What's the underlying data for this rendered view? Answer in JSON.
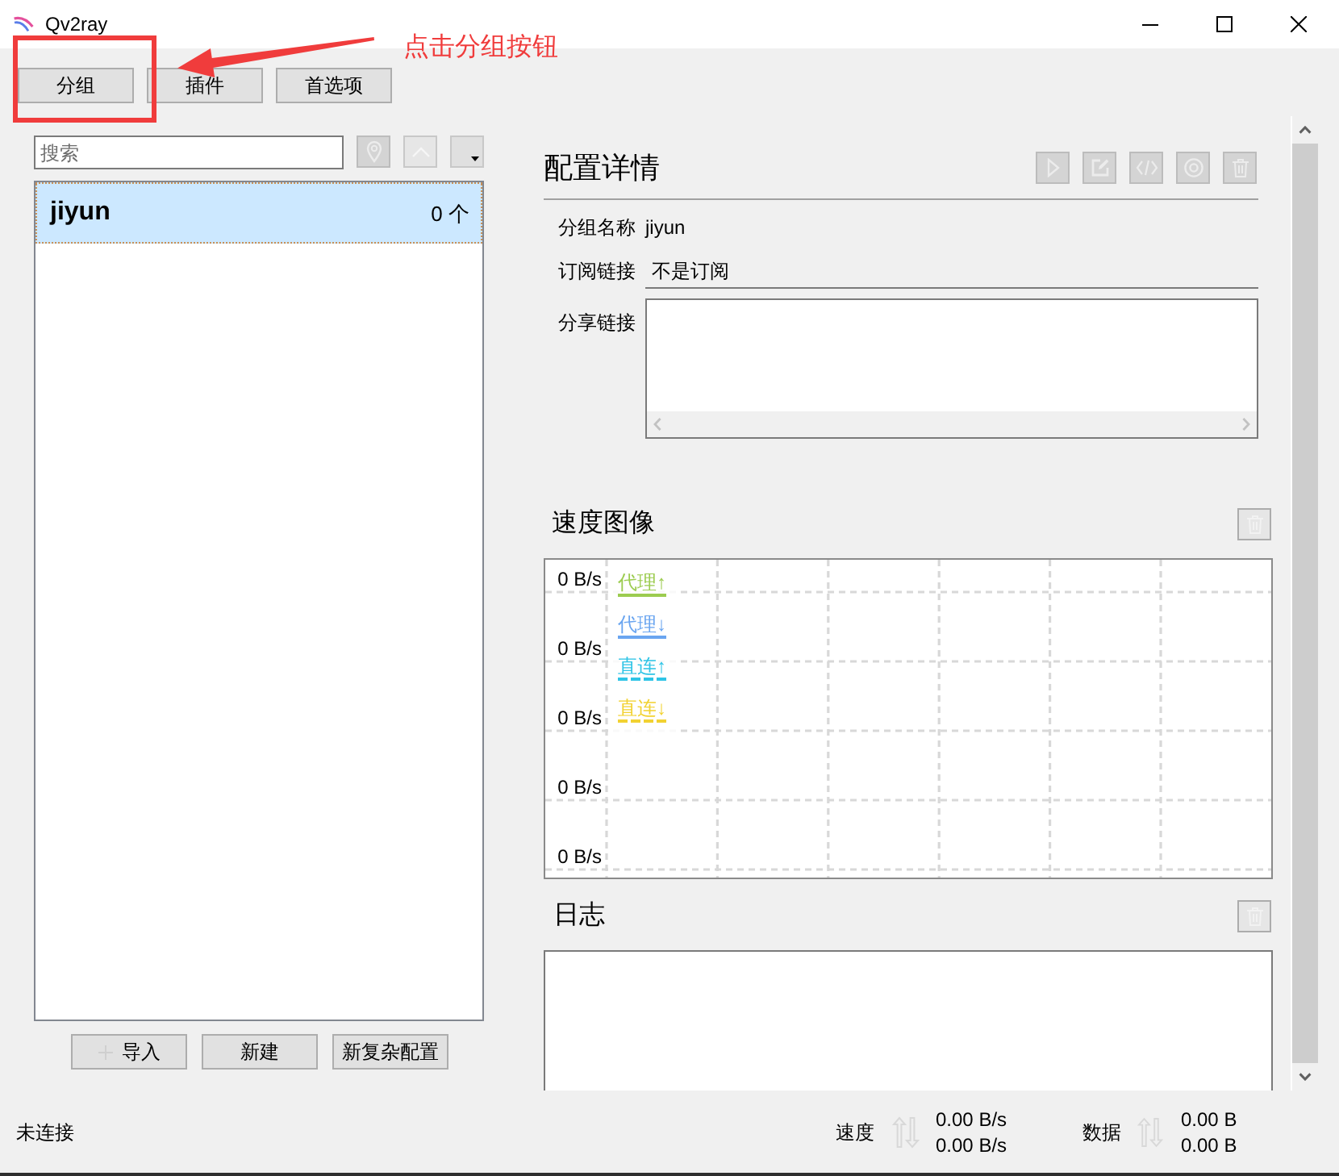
{
  "window": {
    "title": "Qv2ray"
  },
  "annotation": {
    "text": "点击分组按钮"
  },
  "toolbar": [
    {
      "label": "分组"
    },
    {
      "label": "插件"
    },
    {
      "label": "首选项"
    }
  ],
  "group_list": {
    "search": {
      "placeholder": "搜索"
    },
    "items": [
      {
        "name": "jiyun",
        "count": "0 个",
        "selected": true
      }
    ],
    "buttons": [
      {
        "label": "导入",
        "icon": true
      },
      {
        "label": "新建",
        "icon": false
      },
      {
        "label": "新复杂配置",
        "icon": false
      }
    ]
  },
  "details": {
    "title": "配置详情",
    "actions_disabled": true,
    "fields": [
      {
        "kind": "text",
        "label": "分组名称",
        "value": "jiyun"
      },
      {
        "kind": "line",
        "label": "订阅链接",
        "value": "不是订阅"
      },
      {
        "kind": "textarea",
        "label": "分享链接"
      }
    ]
  },
  "speed_chart": {
    "title": "速度图像",
    "clear_disabled": true,
    "y_labels": [
      "0 B/s",
      "0 B/s",
      "0 B/s",
      "0 B/s",
      "0 B/s"
    ],
    "legend": [
      {
        "label": "代理↑",
        "color": "#9ccc50",
        "kind": "solid"
      },
      {
        "label": "代理↓",
        "color": "#6aa5f0",
        "kind": "solid"
      },
      {
        "label": "直连↑",
        "color": "#2ec4e6",
        "kind": "dashed"
      },
      {
        "label": "直连↓",
        "color": "#f2d232",
        "kind": "dashed"
      }
    ]
  },
  "log": {
    "title": "日志",
    "clear_disabled": true
  },
  "status_bar": {
    "connection": "未连接",
    "speed_label": "速度",
    "speed_up": "0.00 B/s",
    "speed_down": "0.00 B/s",
    "data_label": "数据",
    "data_up": "0.00 B",
    "data_down": "0.00 B"
  }
}
